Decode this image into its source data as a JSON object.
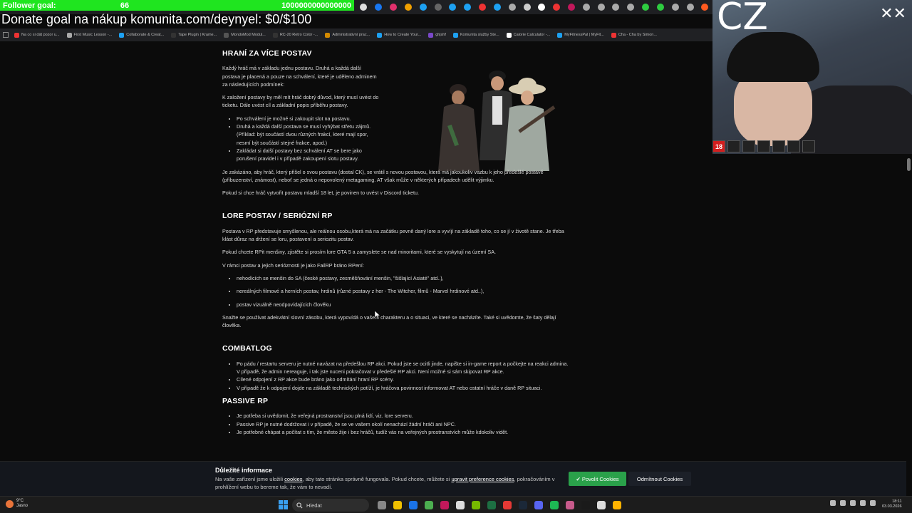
{
  "overlay": {
    "follower_label": "Follower goal:",
    "follower_current": "66",
    "follower_target": "1000000000000000",
    "donate_text": "Donate goal na nákup komunita.com/deynyel: $0/$100",
    "cz_text": "CZ",
    "ratings": [
      "18",
      "",
      "",
      "",
      "",
      "",
      ""
    ]
  },
  "browser": {
    "tab_icon_colors": [
      "#ddd",
      "#1877f2",
      "#e1306c",
      "#f0a000",
      "#1da1f2",
      "#666",
      "#1da1f2",
      "#1da1f2",
      "#e33",
      "#1da1f2",
      "#aaa",
      "#ccc",
      "#fff",
      "#e33",
      "#c2185b",
      "#aaa",
      "#aaa",
      "#aaa",
      "#aaa",
      "#2ecc40",
      "#2ecc40",
      "#aaa",
      "#aaa",
      "#ff5a1f"
    ],
    "bookmarks": [
      {
        "label": "Na co si dát pozor u...",
        "color": "#e33"
      },
      {
        "label": "First Music Lesson -...",
        "color": "#aaa"
      },
      {
        "label": "Collaborate & Creat...",
        "color": "#1da1f2"
      },
      {
        "label": "Tape Plugin | Krame...",
        "color": "#333"
      },
      {
        "label": "MondoMod Modul...",
        "color": "#555"
      },
      {
        "label": "RC-20 Retro Color -...",
        "color": "#333"
      },
      {
        "label": "Administrativní prac...",
        "color": "#d48a00"
      },
      {
        "label": "How to Create Your...",
        "color": "#1da1f2"
      },
      {
        "label": "ghjshf",
        "color": "#7a48c8"
      },
      {
        "label": "Komunita služby Ste...",
        "color": "#1da1f2"
      },
      {
        "label": "Calorie Calculator -...",
        "color": "#fff"
      },
      {
        "label": "MyFitnessPal | MyFit...",
        "color": "#1da1f2"
      },
      {
        "label": "Cha - Cha by Simon...",
        "color": "#e33"
      }
    ]
  },
  "article": {
    "h1": "HRANÍ ZA VÍCE POSTAV",
    "p1": "Každý hráč má v základu jednu postavu. Druhá a každá další postava je placená a pouze na schválení, které je uděleno adminem za následujících podmínek:",
    "p2": "K založení postavy by měl mít hráč dobrý důvod, který musí uvést do ticketu. Dále uvést cíl a základní popis příběhu postavy.",
    "l1": [
      "Po schválení je možné si zakoupit slot na postavu.",
      "Druhá a každá další postava se musí vyhýbat střetu zájmů. (Příklad: být součástí dvou různých frakcí, které mají spor, nesmí být součástí stejné frakce, apod.)",
      "Zakládat si další postavy bez schválení AT se bere jako porušení pravidel i v případě zakoupení slotu postavy."
    ],
    "p3": "Je zakázáno, aby hráč, který přišel o svou postavu (dostal CK), se vrátil s novou postavou, která má jakoukoliv vazbu k jeho předešlé postavě (příbuzenství, známost), neboť se jedná o nepovolený metagaming. AT však může v některých případech udělit výjimku.",
    "p4": "Pokud si chce hráč vytvořit postavu mladší 18 let, je povinen to uvést v Discord ticketu.",
    "h2": "LORE POSTAV / SERIÓZNÍ RP",
    "p5": "Postava v RP představuje smyšlenou, ale reálnou osobu,která má na začátku pevně daný lore a vyvíjí na základě toho, co se jí v životě stane. Je třeba klást důraz na držení se loru, postavení a seriozitu postav.",
    "p6": "Pokud chcete RPit menšiny, zjistěte si prosím lore GTA 5 a zamyslete se nad minoritami, které se vyskytují na území SA.",
    "p7": "V rámci postav a jejich serióznosti je jako FailRP bráno RPení:",
    "l2": [
      "nehodících se menšin do SA (české postavy, zesměšňování menšin, \"šišlající Asiaté\" atd..),",
      "nereálných filmové a herních postav, hrdinů (různé postavy z her - The Witcher, filmů - Marvel hrdinové atd..),",
      "postav vizuálně neodpovídajících člověku"
    ],
    "p8": "Snažte se používat adekvátní slovní zásobu, která vypovídá o vašem charakteru a o situaci, ve které se nacházíte. Také si uvědomte, že šaty dělají člověka.",
    "h3": "COMBATLOG",
    "l3": [
      "Po pádu / restartu serveru je nutné navázat na předešlou RP akci. Pokud jste se ocitli jinde, napište si in-game report a počkejte na reakci admina. V případě, že admin nereaguje, i tak jste nuceni pokračovat v předešlé RP akci. Není možné si sám skipovat RP akce.",
      "Cílené odpojení z RP akce bude bráno jako odmítání hraní RP scény.",
      "V případě že k odpojení dojde na základě technických potíží, je hráčova povinnost informovat AT nebo ostatní hráče v daně RP situaci."
    ],
    "h4": "PASSIVE RP",
    "l4": [
      "Je potřeba si uvědomit, že veřejná prostranství jsou plná lidí, viz. lore serveru.",
      "Passive RP je nutné dodržovat i v případě, že se ve vašem okolí nenachází žádní hráči ani NPC.",
      "Je potřebné chápat a počítat s tím, že město žije i bez hráčů, tudíž vás na veřejných prostranstvích může kdokoliv vidět."
    ]
  },
  "cookie": {
    "title": "Důležité informace",
    "t1": "Na vaše zařízení jsme uložili ",
    "link1": "cookies",
    "t2": ", aby tato stránka správně fungovala. Pokud chcete, můžete si ",
    "link2": "upravit preference cookies",
    "t3": ", pokračováním v prohlížení webu to bereme tak, že vám to nevadí.",
    "accept": "✔ Povolit Cookies",
    "reject": "Odmítnout Cookies"
  },
  "taskbar": {
    "weather_temp": "9°C",
    "weather_desc": "Jasno",
    "search_placeholder": "Hledat",
    "app_colors": [
      "#888",
      "#f0c000",
      "#1a73e8",
      "#4caf50",
      "#c2185b",
      "#ddd",
      "#76b900",
      "#1d6f42",
      "#e53935",
      "#1b2838",
      "#5865f2",
      "#1db954",
      "#c75a8b",
      "#1a1a1a",
      "#ddd",
      "#ffb300"
    ],
    "time": "18:11",
    "date": "03.03.2026"
  }
}
